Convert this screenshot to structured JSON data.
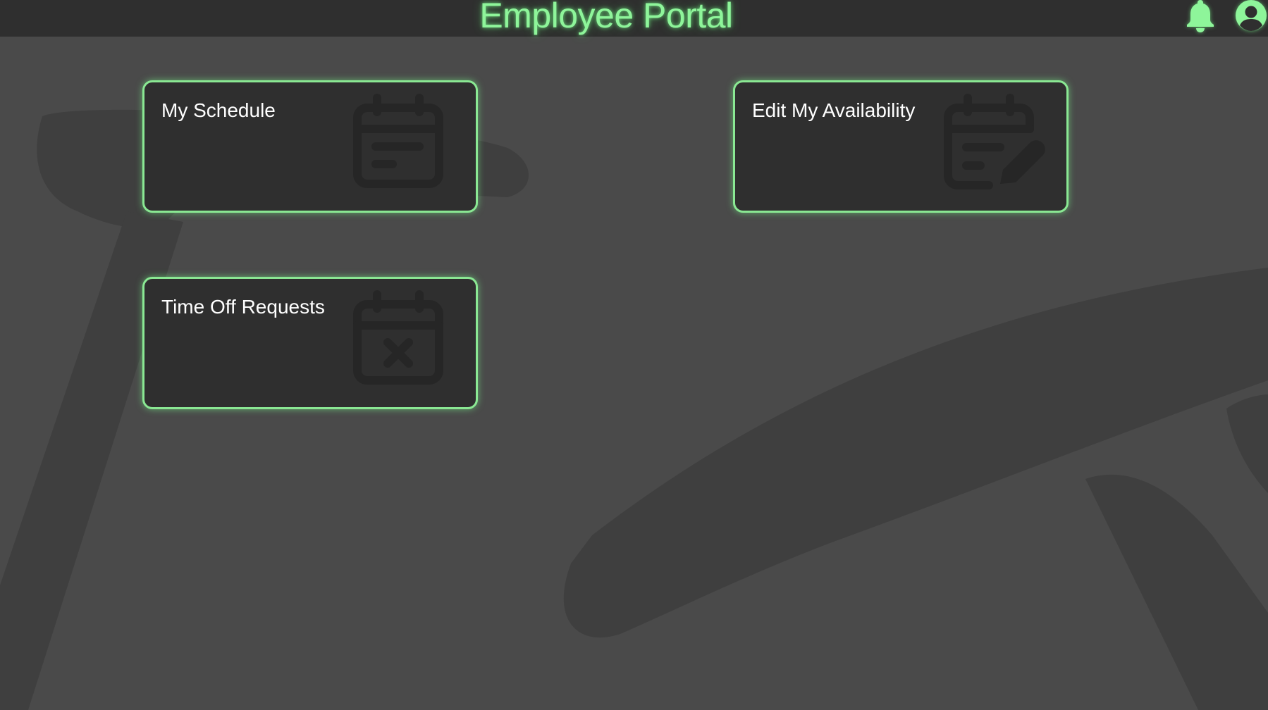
{
  "header": {
    "title": "Employee Portal",
    "icons": [
      "bell-icon",
      "user-circle-icon"
    ]
  },
  "cards": [
    {
      "title": "My Schedule",
      "icon": "calendar-icon"
    },
    {
      "title": "Edit My Availability",
      "icon": "calendar-edit-icon"
    },
    {
      "title": "Time Off Requests",
      "icon": "calendar-x-icon"
    }
  ],
  "colors": {
    "accent": "#8ef59a",
    "card_border": "#8ae893",
    "background": "#4a4a4a",
    "surface": "#2f2f2f",
    "text": "#ffffff"
  }
}
